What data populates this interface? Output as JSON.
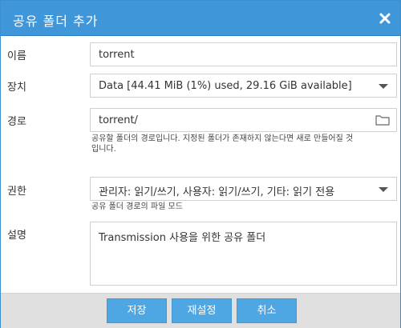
{
  "dialog": {
    "title": "공유 폴더 추가",
    "close_icon": "close-icon"
  },
  "form": {
    "name": {
      "label": "이름",
      "value": "torrent"
    },
    "device": {
      "label": "장치",
      "value": "Data [44.41 MiB (1%) used, 29.16 GiB available]",
      "icon": "chevron-down-icon"
    },
    "path": {
      "label": "경로",
      "value": "torrent/",
      "icon": "folder-icon",
      "hint_line1": "공유할 폴더의 경로입니다. 지정된 폴더가 존재하지 않는다면 새로 만들어질 것",
      "hint_line2": "입니다."
    },
    "permissions": {
      "label": "권한",
      "value": "관리자: 읽기/쓰기, 사용자: 읽기/쓰기, 기타: 읽기 전용",
      "icon": "chevron-down-icon",
      "hint": "공유 폴더 경로의 파일 모드"
    },
    "description": {
      "label": "설명",
      "value": "Transmission 사용을 위한 공유 폴더"
    }
  },
  "buttons": {
    "save": "저장",
    "reset": "재설정",
    "cancel": "취소"
  },
  "colors": {
    "titlebar": "#3f96d8",
    "button": "#4ea6e3",
    "footer": "#e0e0e0"
  }
}
